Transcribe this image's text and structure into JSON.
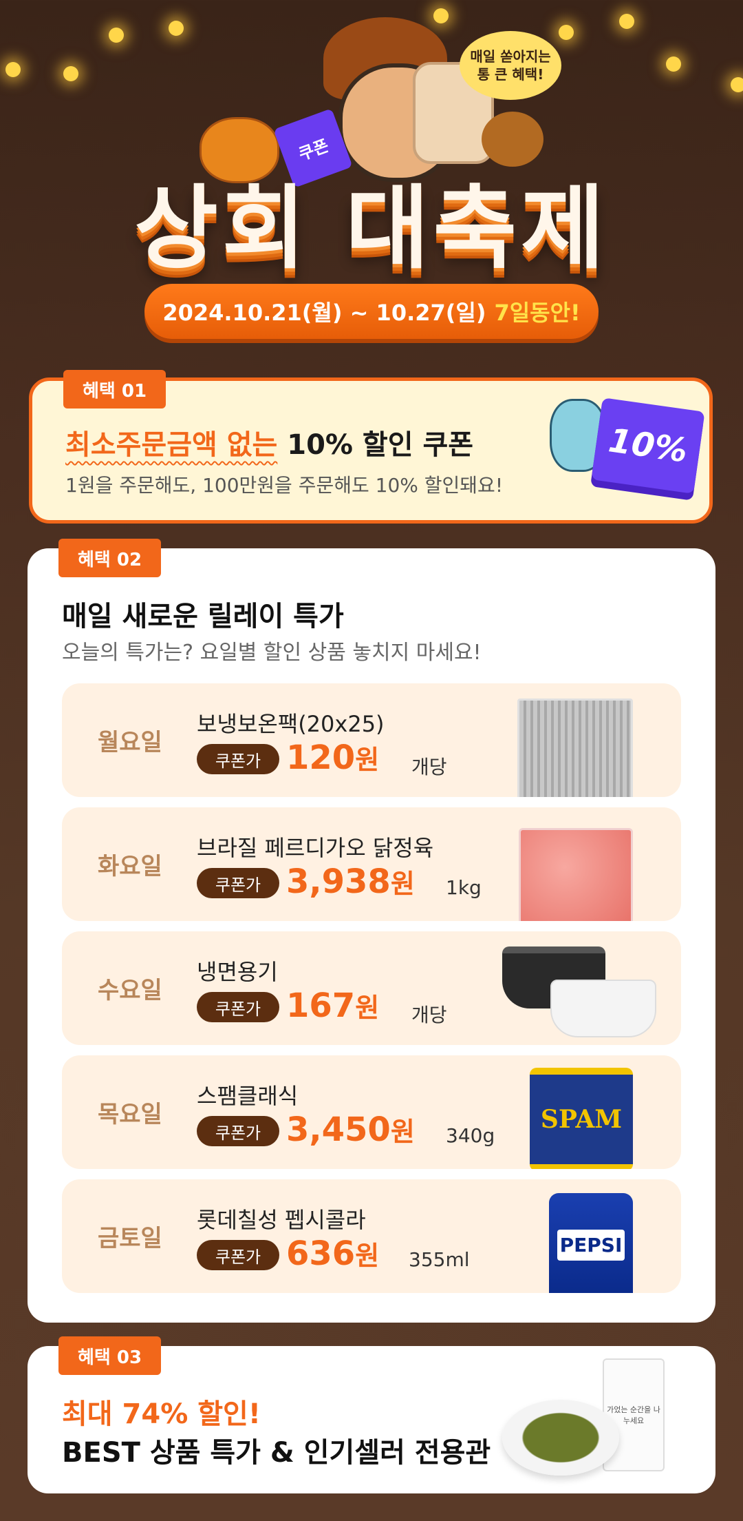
{
  "hero": {
    "bubble_line1": "매일 쏟아지는",
    "bubble_line2": "통 큰 혜택!",
    "coupon_label": "쿠폰",
    "title": "상회 대축제",
    "date_range": "2024.10.21(월) ~ 10.27(일)",
    "date_highlight": "7일동안!"
  },
  "benefit1": {
    "tag": "혜택 01",
    "headline_highlight": "최소주문금액 없는",
    "headline_rest": "10% 할인 쿠폰",
    "subtitle": "1원을 주문해도, 100만원을 주문해도 10% 할인돼요!",
    "ticket_text": "10%"
  },
  "benefit2": {
    "tag": "혜택 02",
    "title": "매일 새로운 릴레이 특가",
    "subtitle": "오늘의 특가는? 요일별 할인 상품 놓치지 마세요!",
    "badge_label": "쿠폰가",
    "items": [
      {
        "day": "월요일",
        "name": "보냉보온팩(20x25)",
        "price": "120",
        "won": "원",
        "unit": "개당",
        "image": "insulated-pack-image"
      },
      {
        "day": "화요일",
        "name": "브라질 페르디가오 닭정육",
        "price": "3,938",
        "won": "원",
        "unit": "1kg",
        "image": "chicken-pack-image"
      },
      {
        "day": "수요일",
        "name": "냉면용기",
        "price": "167",
        "won": "원",
        "unit": "개당",
        "image": "noodle-bowl-image"
      },
      {
        "day": "목요일",
        "name": "스팸클래식",
        "price": "3,450",
        "won": "원",
        "unit": "340g",
        "image": "spam-can-image",
        "label": "SPAM"
      },
      {
        "day": "금토일",
        "name": "롯데칠성 펩시콜라",
        "price": "636",
        "won": "원",
        "unit": "355ml",
        "image": "pepsi-can-image",
        "label": "PEPSI"
      }
    ]
  },
  "benefit3": {
    "tag": "혜택 03",
    "line1": "최대 74% 할인!",
    "line2": "BEST 상품 특가 & 인기셀러 전용관",
    "bag_text": "가었는 순간을 나누세요"
  },
  "colors": {
    "accent": "#f2671a",
    "badge": "#5c2e10",
    "row_bg": "#fff1e2",
    "ticket": "#6a40f2"
  }
}
